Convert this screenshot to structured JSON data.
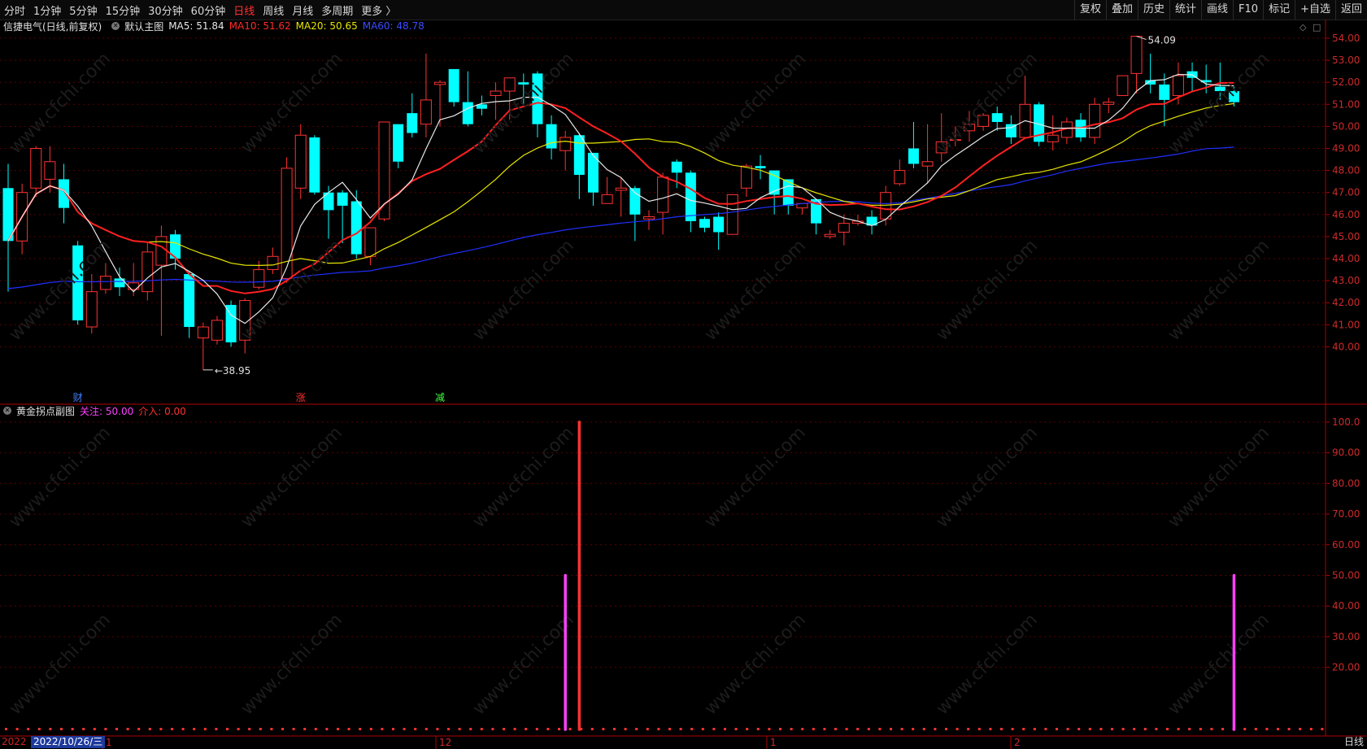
{
  "toolbar": {
    "left_items": [
      "分时",
      "1分钟",
      "5分钟",
      "15分钟",
      "30分钟",
      "60分钟",
      "日线",
      "周线",
      "月线",
      "多周期",
      "更多 〉"
    ],
    "active_item": "日线",
    "right_items": [
      "复权",
      "叠加",
      "历史",
      "统计",
      "画线",
      "F10",
      "标记",
      "+自选",
      "返回"
    ]
  },
  "main_header": {
    "stock": "信捷电气(日线,前复权)",
    "main_chart": "默认主图",
    "ma5": "MA5: 51.84",
    "ma10": "MA10: 51.62",
    "ma20": "MA20: 50.65",
    "ma60": "MA60: 48.78"
  },
  "sub_header": {
    "title": "黄金拐点副图",
    "focus": "关注: 50.00",
    "enter": "介入: 0.00"
  },
  "colors": {
    "up": "#ff3232",
    "down": "#00ffff",
    "ma5": "#e8e8e8",
    "ma10": "#ff2020",
    "ma20": "#e6e600",
    "ma60": "#2030ff",
    "axis": "#b00000",
    "focus": "#ff40ff"
  },
  "price_axis": {
    "labels": [
      "54.00",
      "53.00",
      "52.00",
      "51.00",
      "50.00",
      "49.00",
      "48.00",
      "47.00",
      "46.00",
      "45.00",
      "44.00",
      "43.00",
      "42.00",
      "41.00",
      "40.00"
    ]
  },
  "sub_axis": {
    "labels": [
      "100.0",
      "90.00",
      "80.00",
      "70.00",
      "60.00",
      "50.00",
      "40.00",
      "30.00",
      "20.00"
    ]
  },
  "annotations": {
    "high": "54.09",
    "low": "38.95"
  },
  "event_markers": [
    "财",
    "涨",
    "减"
  ],
  "date_axis": {
    "current": "2022/10/26/三",
    "left_edge": "2022",
    "month_labels": [
      "1",
      "12",
      "1",
      "2"
    ]
  },
  "period_label": "日线",
  "chart_data": {
    "type": "candlestick",
    "candles": [
      [
        47.2,
        44.8,
        48.3,
        42.5
      ],
      [
        44.8,
        47.0,
        47.4,
        44.2
      ],
      [
        47.2,
        49.0,
        49.1,
        46.8
      ],
      [
        47.6,
        48.4,
        49.1,
        47.0
      ],
      [
        47.6,
        46.3,
        48.3,
        45.6
      ],
      [
        44.6,
        41.2,
        44.8,
        41.0
      ],
      [
        40.9,
        42.5,
        43.3,
        40.6
      ],
      [
        42.6,
        43.2,
        43.8,
        42.4
      ],
      [
        43.1,
        42.7,
        43.6,
        42.3
      ],
      [
        42.6,
        42.9,
        43.8,
        42.3
      ],
      [
        42.5,
        44.3,
        44.7,
        42.1
      ],
      [
        43.7,
        45.0,
        45.5,
        40.5
      ],
      [
        45.1,
        44.0,
        45.3,
        43.5
      ],
      [
        43.3,
        40.9,
        43.4,
        40.4
      ],
      [
        40.4,
        40.9,
        41.1,
        38.95
      ],
      [
        40.3,
        41.2,
        41.4,
        40.1
      ],
      [
        41.9,
        40.2,
        42.1,
        40.0
      ],
      [
        40.3,
        42.1,
        42.2,
        39.7
      ],
      [
        42.7,
        43.5,
        43.9,
        42.6
      ],
      [
        43.5,
        44.1,
        44.5,
        43.3
      ],
      [
        43.1,
        48.1,
        48.6,
        42.9
      ],
      [
        47.2,
        49.6,
        50.1,
        46.7
      ],
      [
        49.5,
        47.0,
        49.6,
        46.9
      ],
      [
        47.0,
        46.2,
        47.3,
        44.9
      ],
      [
        47.0,
        46.4,
        47.1,
        44.7
      ],
      [
        46.6,
        44.2,
        47.1,
        44.0
      ],
      [
        44.1,
        45.4,
        45.4,
        43.7
      ],
      [
        45.8,
        50.2,
        50.2,
        45.7
      ],
      [
        50.1,
        48.4,
        50.1,
        48.1
      ],
      [
        50.6,
        49.7,
        51.5,
        49.5
      ],
      [
        50.1,
        51.2,
        53.3,
        49.5
      ],
      [
        51.9,
        52.0,
        52.1,
        50.0
      ],
      [
        52.6,
        51.1,
        52.6,
        50.9
      ],
      [
        51.1,
        50.1,
        52.5,
        50.0
      ],
      [
        51.0,
        50.8,
        51.4,
        50.5
      ],
      [
        51.4,
        51.6,
        52.0,
        50.3
      ],
      [
        51.6,
        52.2,
        52.1,
        50.3
      ],
      [
        52.0,
        51.9,
        52.4,
        51.0
      ],
      [
        52.4,
        50.1,
        52.5,
        49.5
      ],
      [
        50.1,
        49.0,
        50.5,
        48.5
      ],
      [
        48.9,
        49.5,
        49.8,
        48.0
      ],
      [
        49.6,
        47.8,
        49.7,
        46.7
      ],
      [
        48.8,
        47.0,
        48.6,
        46.4
      ],
      [
        46.5,
        46.9,
        47.7,
        46.6
      ],
      [
        47.1,
        47.2,
        47.7,
        45.9
      ],
      [
        47.2,
        46.0,
        47.3,
        44.8
      ],
      [
        45.8,
        45.9,
        46.2,
        45.3
      ],
      [
        46.1,
        47.7,
        47.9,
        45.1
      ],
      [
        48.4,
        47.9,
        48.5,
        47.2
      ],
      [
        47.9,
        45.7,
        48.0,
        45.2
      ],
      [
        45.8,
        45.4,
        45.9,
        45.2
      ],
      [
        45.9,
        45.2,
        46.1,
        44.4
      ],
      [
        45.1,
        46.9,
        46.9,
        45.4
      ],
      [
        47.2,
        48.2,
        48.3,
        46.8
      ],
      [
        48.2,
        48.1,
        48.7,
        47.6
      ],
      [
        48.0,
        46.9,
        48.0,
        46.0
      ],
      [
        47.6,
        46.4,
        47.6,
        46.0
      ],
      [
        46.3,
        46.5,
        46.4,
        46.0
      ],
      [
        46.7,
        45.6,
        46.7,
        45.1
      ],
      [
        45.0,
        45.1,
        45.3,
        44.9
      ],
      [
        45.2,
        45.6,
        46.0,
        44.6
      ],
      [
        45.6,
        45.7,
        46.0,
        45.5
      ],
      [
        45.9,
        45.5,
        46.2,
        45.1
      ],
      [
        45.8,
        47.0,
        47.3,
        45.5
      ],
      [
        47.4,
        48.0,
        48.5,
        47.3
      ],
      [
        49.0,
        48.3,
        50.2,
        48.1
      ],
      [
        48.2,
        48.4,
        50.1,
        47.4
      ],
      [
        48.8,
        49.3,
        50.6,
        48.4
      ],
      [
        49.4,
        49.4,
        50.0,
        49.1
      ],
      [
        49.8,
        50.1,
        50.7,
        49.3
      ],
      [
        50.0,
        50.5,
        50.6,
        49.8
      ],
      [
        50.6,
        50.2,
        50.9,
        49.8
      ],
      [
        50.1,
        49.5,
        50.5,
        49.2
      ],
      [
        49.5,
        51.0,
        52.3,
        49.5
      ],
      [
        51.0,
        49.3,
        51.1,
        49.1
      ],
      [
        49.3,
        49.6,
        50.5,
        48.9
      ],
      [
        49.5,
        50.2,
        50.4,
        49.2
      ],
      [
        50.3,
        49.5,
        50.6,
        49.3
      ],
      [
        49.5,
        51.0,
        51.3,
        49.2
      ],
      [
        51.0,
        51.1,
        51.3,
        50.6
      ],
      [
        51.4,
        52.3,
        52.3,
        51.5
      ],
      [
        52.4,
        54.09,
        54.09,
        51.5
      ],
      [
        52.1,
        51.9,
        53.3,
        51.5
      ],
      [
        51.9,
        51.2,
        52.4,
        50.0
      ],
      [
        51.4,
        52.3,
        52.9,
        51.0
      ],
      [
        52.5,
        52.2,
        52.9,
        51.6
      ],
      [
        52.1,
        52.0,
        52.8,
        51.5
      ],
      [
        51.8,
        51.6,
        52.9,
        51.2
      ],
      [
        51.6,
        51.1,
        51.8,
        50.9
      ]
    ],
    "indicator_bars": [
      {
        "candle": 40,
        "value": 50,
        "kind": "focus"
      },
      {
        "candle": 41,
        "value": 100,
        "kind": "enter"
      },
      {
        "candle": 88,
        "value": 50,
        "kind": "focus"
      }
    ]
  }
}
